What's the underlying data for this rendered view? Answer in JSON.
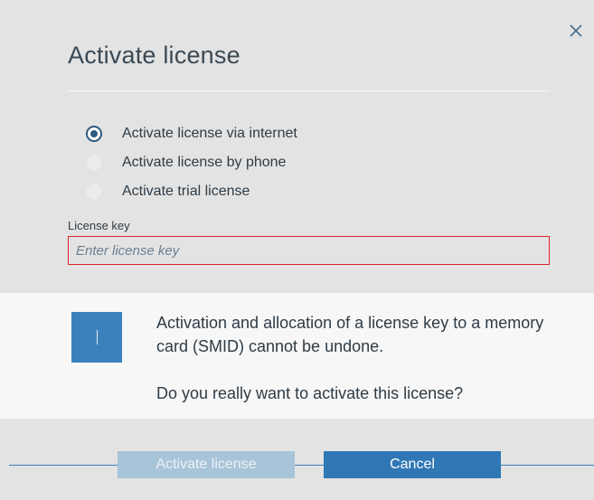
{
  "dialog": {
    "title": "Activate license",
    "close_icon": "close-icon"
  },
  "options": [
    {
      "label": "Activate license via internet",
      "selected": true
    },
    {
      "label": "Activate license by phone",
      "selected": false
    },
    {
      "label": "Activate trial license",
      "selected": false
    }
  ],
  "license_key": {
    "label": "License key",
    "placeholder": "Enter license key",
    "value": ""
  },
  "info": {
    "icon": "info-icon",
    "message": "Activation and allocation of a license key to a memory card (SMID) cannot be undone.",
    "question": "Do you really want to activate this license?"
  },
  "buttons": {
    "activate_label": "Activate license",
    "activate_enabled": false,
    "cancel_label": "Cancel"
  },
  "colors": {
    "accent": "#2f78b5",
    "disabled_button": "#a8c4d8",
    "info_icon": "#3b82bb",
    "error_border": "#e0242a"
  }
}
